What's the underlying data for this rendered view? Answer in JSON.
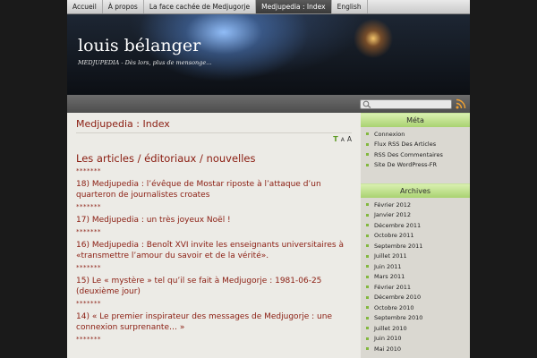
{
  "nav": {
    "items": [
      {
        "label": "Accueil",
        "active": false
      },
      {
        "label": "À propos",
        "active": false
      },
      {
        "label": "La face cachée de Medjugorje",
        "active": false
      },
      {
        "label": "Medjupedia : Index",
        "active": true
      },
      {
        "label": "English",
        "active": false
      }
    ]
  },
  "header": {
    "site_title": "louis bélanger",
    "tagline": "MEDJUPEDIA - Dès lors, plus de mensonge…"
  },
  "searchbar": {
    "search_placeholder": "",
    "search_icon": "search-icon",
    "rss_icon": "rss-icon",
    "rss_color": "#f0a030"
  },
  "content": {
    "page_title": "Medjupedia : Index",
    "font_tools": {
      "green": "T",
      "small": "A",
      "large": "A"
    },
    "section_title": "Les articles / éditoriaux / nouvelles",
    "stars": "*******",
    "articles": [
      "18) Medjupedia : l’évêque de Mostar riposte à l’attaque d’un quarteron de journalistes croates",
      "17) Medjupedia : un très joyeux Noël !",
      "16) Medjupedia : Benoît XVI invite les enseignants universitaires à «transmettre l’amour du savoir et de la vérité».",
      "15) Le « mystère » tel qu’il se fait à Medjugorje : 1981-06-25 (deuxième jour)",
      "14) « Le premier inspirateur des messages de Medjugorje : une connexion surprenante… »"
    ],
    "accent_color": "#8a1c10"
  },
  "sidebar": {
    "meta": {
      "title": "Méta",
      "items": [
        "Connexion",
        "Flux RSS Des Articles",
        "RSS Des Commentaires",
        "Site De WordPress-FR"
      ]
    },
    "archives": {
      "title": "Archives",
      "items": [
        "Février 2012",
        "Janvier 2012",
        "Décembre 2011",
        "Octobre 2011",
        "Septembre 2011",
        "Juillet 2011",
        "Juin 2011",
        "Mars 2011",
        "Février 2011",
        "Décembre 2010",
        "Octobre 2010",
        "Septembre 2010",
        "Juillet 2010",
        "Juin 2010",
        "Mai 2010"
      ]
    },
    "head_color": "#a9d271"
  }
}
